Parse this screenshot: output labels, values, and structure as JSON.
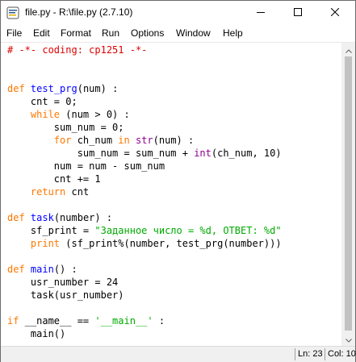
{
  "window": {
    "title": "file.py - R:\\file.py (2.7.10)",
    "icons": {
      "app": "python-idle-icon",
      "minimize": "minimize-icon",
      "maximize": "maximize-icon",
      "close": "close-icon"
    }
  },
  "menu": {
    "items": [
      "File",
      "Edit",
      "Format",
      "Run",
      "Options",
      "Window",
      "Help"
    ]
  },
  "colors": {
    "keyword": "#ff7700",
    "definition": "#0000ff",
    "string": "#00aa00",
    "comment": "#dd0000",
    "builtin": "#900090"
  },
  "editor": {
    "lines": [
      [
        {
          "t": "# -*- coding: cp1251 -*-",
          "c": "cmt"
        }
      ],
      [],
      [],
      [
        {
          "t": "def",
          "c": "kw"
        },
        {
          "t": " "
        },
        {
          "t": "test_prg",
          "c": "fn"
        },
        {
          "t": "(num) :"
        }
      ],
      [
        {
          "t": "    cnt = 0;"
        }
      ],
      [
        {
          "t": "    "
        },
        {
          "t": "while",
          "c": "kw"
        },
        {
          "t": " (num > 0) :"
        }
      ],
      [
        {
          "t": "        sum_num = 0;"
        }
      ],
      [
        {
          "t": "        "
        },
        {
          "t": "for",
          "c": "kw"
        },
        {
          "t": " ch_num "
        },
        {
          "t": "in",
          "c": "kw"
        },
        {
          "t": " "
        },
        {
          "t": "str",
          "c": "bi"
        },
        {
          "t": "(num) :"
        }
      ],
      [
        {
          "t": "            sum_num = sum_num + "
        },
        {
          "t": "int",
          "c": "bi"
        },
        {
          "t": "(ch_num, 10)"
        }
      ],
      [
        {
          "t": "        num = num - sum_num"
        }
      ],
      [
        {
          "t": "        cnt += 1"
        }
      ],
      [
        {
          "t": "    "
        },
        {
          "t": "return",
          "c": "kw"
        },
        {
          "t": " cnt"
        }
      ],
      [],
      [
        {
          "t": "def",
          "c": "kw"
        },
        {
          "t": " "
        },
        {
          "t": "task",
          "c": "fn"
        },
        {
          "t": "(number) :"
        }
      ],
      [
        {
          "t": "    sf_print = "
        },
        {
          "t": "\"Заданное число = %d, ОТВЕТ: %d\"",
          "c": "str"
        }
      ],
      [
        {
          "t": "    "
        },
        {
          "t": "print",
          "c": "kw"
        },
        {
          "t": " (sf_print%(number, test_prg(number)))"
        }
      ],
      [],
      [
        {
          "t": "def",
          "c": "kw"
        },
        {
          "t": " "
        },
        {
          "t": "main",
          "c": "fn"
        },
        {
          "t": "() :"
        }
      ],
      [
        {
          "t": "    usr_number = 24"
        }
      ],
      [
        {
          "t": "    task(usr_number)"
        }
      ],
      [],
      [
        {
          "t": "if",
          "c": "kw"
        },
        {
          "t": " __name__ == "
        },
        {
          "t": "'__main__'",
          "c": "str"
        },
        {
          "t": " :"
        }
      ],
      [
        {
          "t": "    main()"
        }
      ]
    ]
  },
  "status": {
    "line": "Ln: 23",
    "col": "Col: 10"
  }
}
